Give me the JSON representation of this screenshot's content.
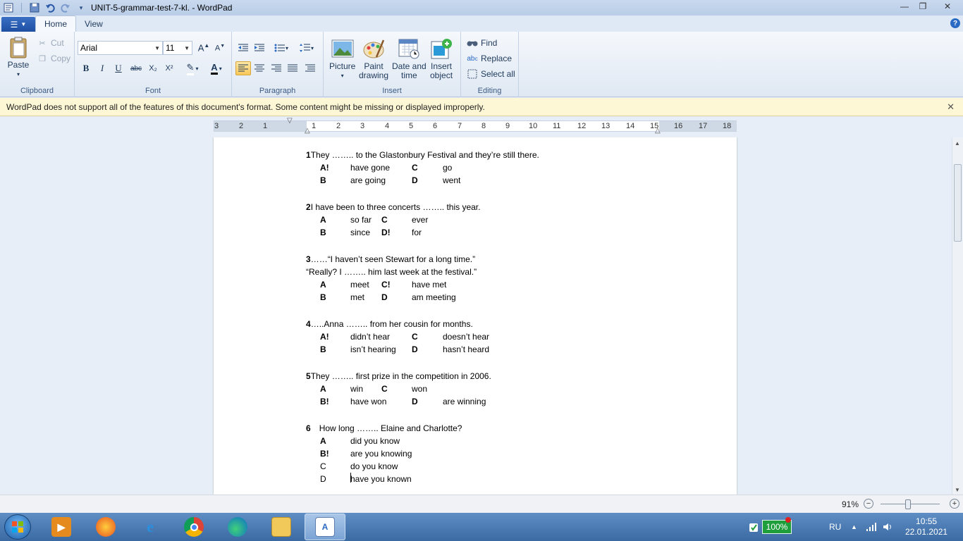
{
  "window": {
    "title": "UNIT-5-grammar-test-7-kl. - WordPad",
    "controls": {
      "minimize": "—",
      "maximize": "❐",
      "close": "✕"
    }
  },
  "tabs": {
    "home": "Home",
    "view": "View"
  },
  "ribbon": {
    "clipboard": {
      "label": "Clipboard",
      "paste": "Paste",
      "cut": "Cut",
      "copy": "Copy"
    },
    "font": {
      "label": "Font",
      "family": "Arial",
      "size": "11",
      "bold": "B",
      "italic": "I",
      "underline": "U",
      "strike": "abc",
      "subscript": "X₂",
      "superscript": "X²"
    },
    "paragraph": {
      "label": "Paragraph"
    },
    "insert": {
      "label": "Insert",
      "picture": "Picture",
      "paint_drawing_1": "Paint",
      "paint_drawing_2": "drawing",
      "datetime_1": "Date and",
      "datetime_2": "time",
      "insert_object_1": "Insert",
      "insert_object_2": "object"
    },
    "editing": {
      "label": "Editing",
      "find": "Find",
      "replace": "Replace",
      "select_all": "Select all"
    }
  },
  "infobar": {
    "message": "WordPad does not support all of the features of this document's format. Some content might be missing or displayed improperly."
  },
  "ruler": {
    "numbers": [
      "3",
      "2",
      "1",
      "1",
      "2",
      "3",
      "4",
      "5",
      "6",
      "7",
      "8",
      "9",
      "10",
      "11",
      "12",
      "13",
      "14",
      "15",
      "16",
      "17",
      "18"
    ]
  },
  "document": {
    "q1": {
      "num": "1",
      "text": "They …….. to the Glastonbury Festival and they’re still there.",
      "options": [
        {
          "l1": "A!",
          "t1": "have gone",
          "l2": "C",
          "t2": "go"
        },
        {
          "l1": "B",
          "t1": "are going",
          "l2": "D",
          "t2": "went"
        }
      ]
    },
    "q2": {
      "num": "2",
      "text": "I have been to three concerts …….. this year.",
      "options": [
        {
          "l1": "A",
          "t1": "so far",
          "l2": "C",
          "t2": "ever"
        },
        {
          "l1": "B",
          "t1": "since",
          "l2": "D!",
          "t2": "for"
        }
      ]
    },
    "q3": {
      "num": "3",
      "text": "……“I haven’t seen Stewart for a long time.”",
      "text2": "“Really? I …….. him last week at the festival.”",
      "options": [
        {
          "l1": "A",
          "t1": "meet",
          "l2": "C!",
          "t2": "have met"
        },
        {
          "l1": "B",
          "t1": "met",
          "l2": "D",
          "t2": "am meeting"
        }
      ]
    },
    "q4": {
      "num": "4",
      "text": "…..Anna …….. from her cousin for months.",
      "options": [
        {
          "l1": "A!",
          "t1": "didn’t hear",
          "l2": "C",
          "t2": "doesn’t hear"
        },
        {
          "l1": "B",
          "t1": "isn’t hearing",
          "l2": "D",
          "t2": "hasn’t heard"
        }
      ]
    },
    "q5": {
      "num": "5",
      "text": "They …….. first prize in the competition in 2006.",
      "options": [
        {
          "l1": "A",
          "t1": "win",
          "l2": "C",
          "t2": "won"
        },
        {
          "l1": "B!",
          "t1": "have won",
          "l2": "D",
          "t2": "are winning"
        }
      ]
    },
    "q6": {
      "num": "6",
      "text": "How long …….. Elaine and Charlotte?",
      "options": [
        {
          "l": "A",
          "t": "did you know"
        },
        {
          "l": "B!",
          "t": "are you knowing"
        },
        {
          "l": "C",
          "t": "do you know"
        },
        {
          "l": "D",
          "t": "have you known"
        }
      ]
    }
  },
  "statusbar": {
    "zoom": "91%",
    "zoom_level_percent": 91,
    "zoom_out": "−",
    "zoom_in": "+"
  },
  "taskbar": {
    "battery": "100%",
    "language": "RU",
    "time": "10:55",
    "date": "22.01.2021",
    "apps": [
      "media-player",
      "firefox",
      "internet-explorer",
      "chrome",
      "edge",
      "file-explorer",
      "wordpad"
    ]
  },
  "colors": {
    "accent": "#2a69c4",
    "infobar_bg": "#fdf7d5",
    "battery": "#1f9e3c",
    "taskbar": "#4a7bb5"
  }
}
